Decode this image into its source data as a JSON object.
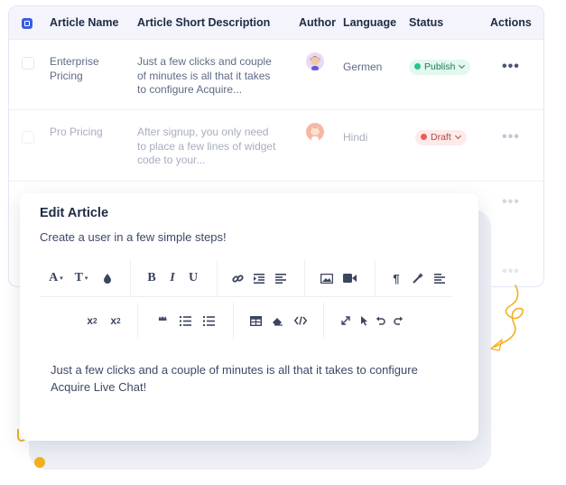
{
  "table": {
    "columns": [
      "Article Name",
      "Article Short Description",
      "Author",
      "Language",
      "Status",
      "Actions"
    ],
    "rows": [
      {
        "name_line1": "Enterprise",
        "name_line2": "Pricing",
        "desc_line1": "Just a few clicks and couple",
        "desc_line2": "of minutes is all that it takes",
        "desc_line3": "to configure Acquire...",
        "language": "Germen",
        "status": "Publish",
        "status_color": "#22c58b"
      },
      {
        "name_line1": "Pro Pricing",
        "name_line2": "",
        "desc_line1": "After signup, you only need",
        "desc_line2": "to place a few lines of widget",
        "desc_line3": "code to your...",
        "language": "Hindi",
        "status": "Draft",
        "status_color": "#ef5c5c"
      }
    ],
    "actions_glyph": "•••"
  },
  "editor": {
    "title": "Edit Article",
    "subtitle": "Create a user in a few simple steps!",
    "toolbar_row1": [
      "font-family-icon",
      "font-size-icon",
      "text-color-icon",
      "bold-icon",
      "italic-icon",
      "underline-icon",
      "link-icon",
      "indent-icon",
      "align-left-icon",
      "image-icon",
      "video-icon",
      "paragraph-icon",
      "magic-wand-icon",
      "align-icon"
    ],
    "toolbar_row2": [
      "subscript-icon",
      "superscript-icon",
      "quote-icon",
      "ordered-list-icon",
      "unordered-list-icon",
      "table-icon",
      "eraser-icon",
      "code-icon",
      "fullscreen-icon",
      "select-icon",
      "undo-icon",
      "redo-icon"
    ],
    "labels": {
      "font": "A",
      "size": "T",
      "bold": "B",
      "italic": "I",
      "underline": "U",
      "sub": "x",
      "sub_index": "2",
      "sup": "x",
      "sup_index": "2",
      "quote": "❝❝"
    },
    "content_line1": "Just a few clicks and a couple of minutes is all that it takes to configure",
    "content_line2": "Acquire Live Chat!"
  },
  "colors": {
    "accent": "#3b5ce0",
    "publish_bg": "#e3f8ef",
    "draft_bg": "#fdeaea",
    "decor_orange": "#f2b01e"
  }
}
